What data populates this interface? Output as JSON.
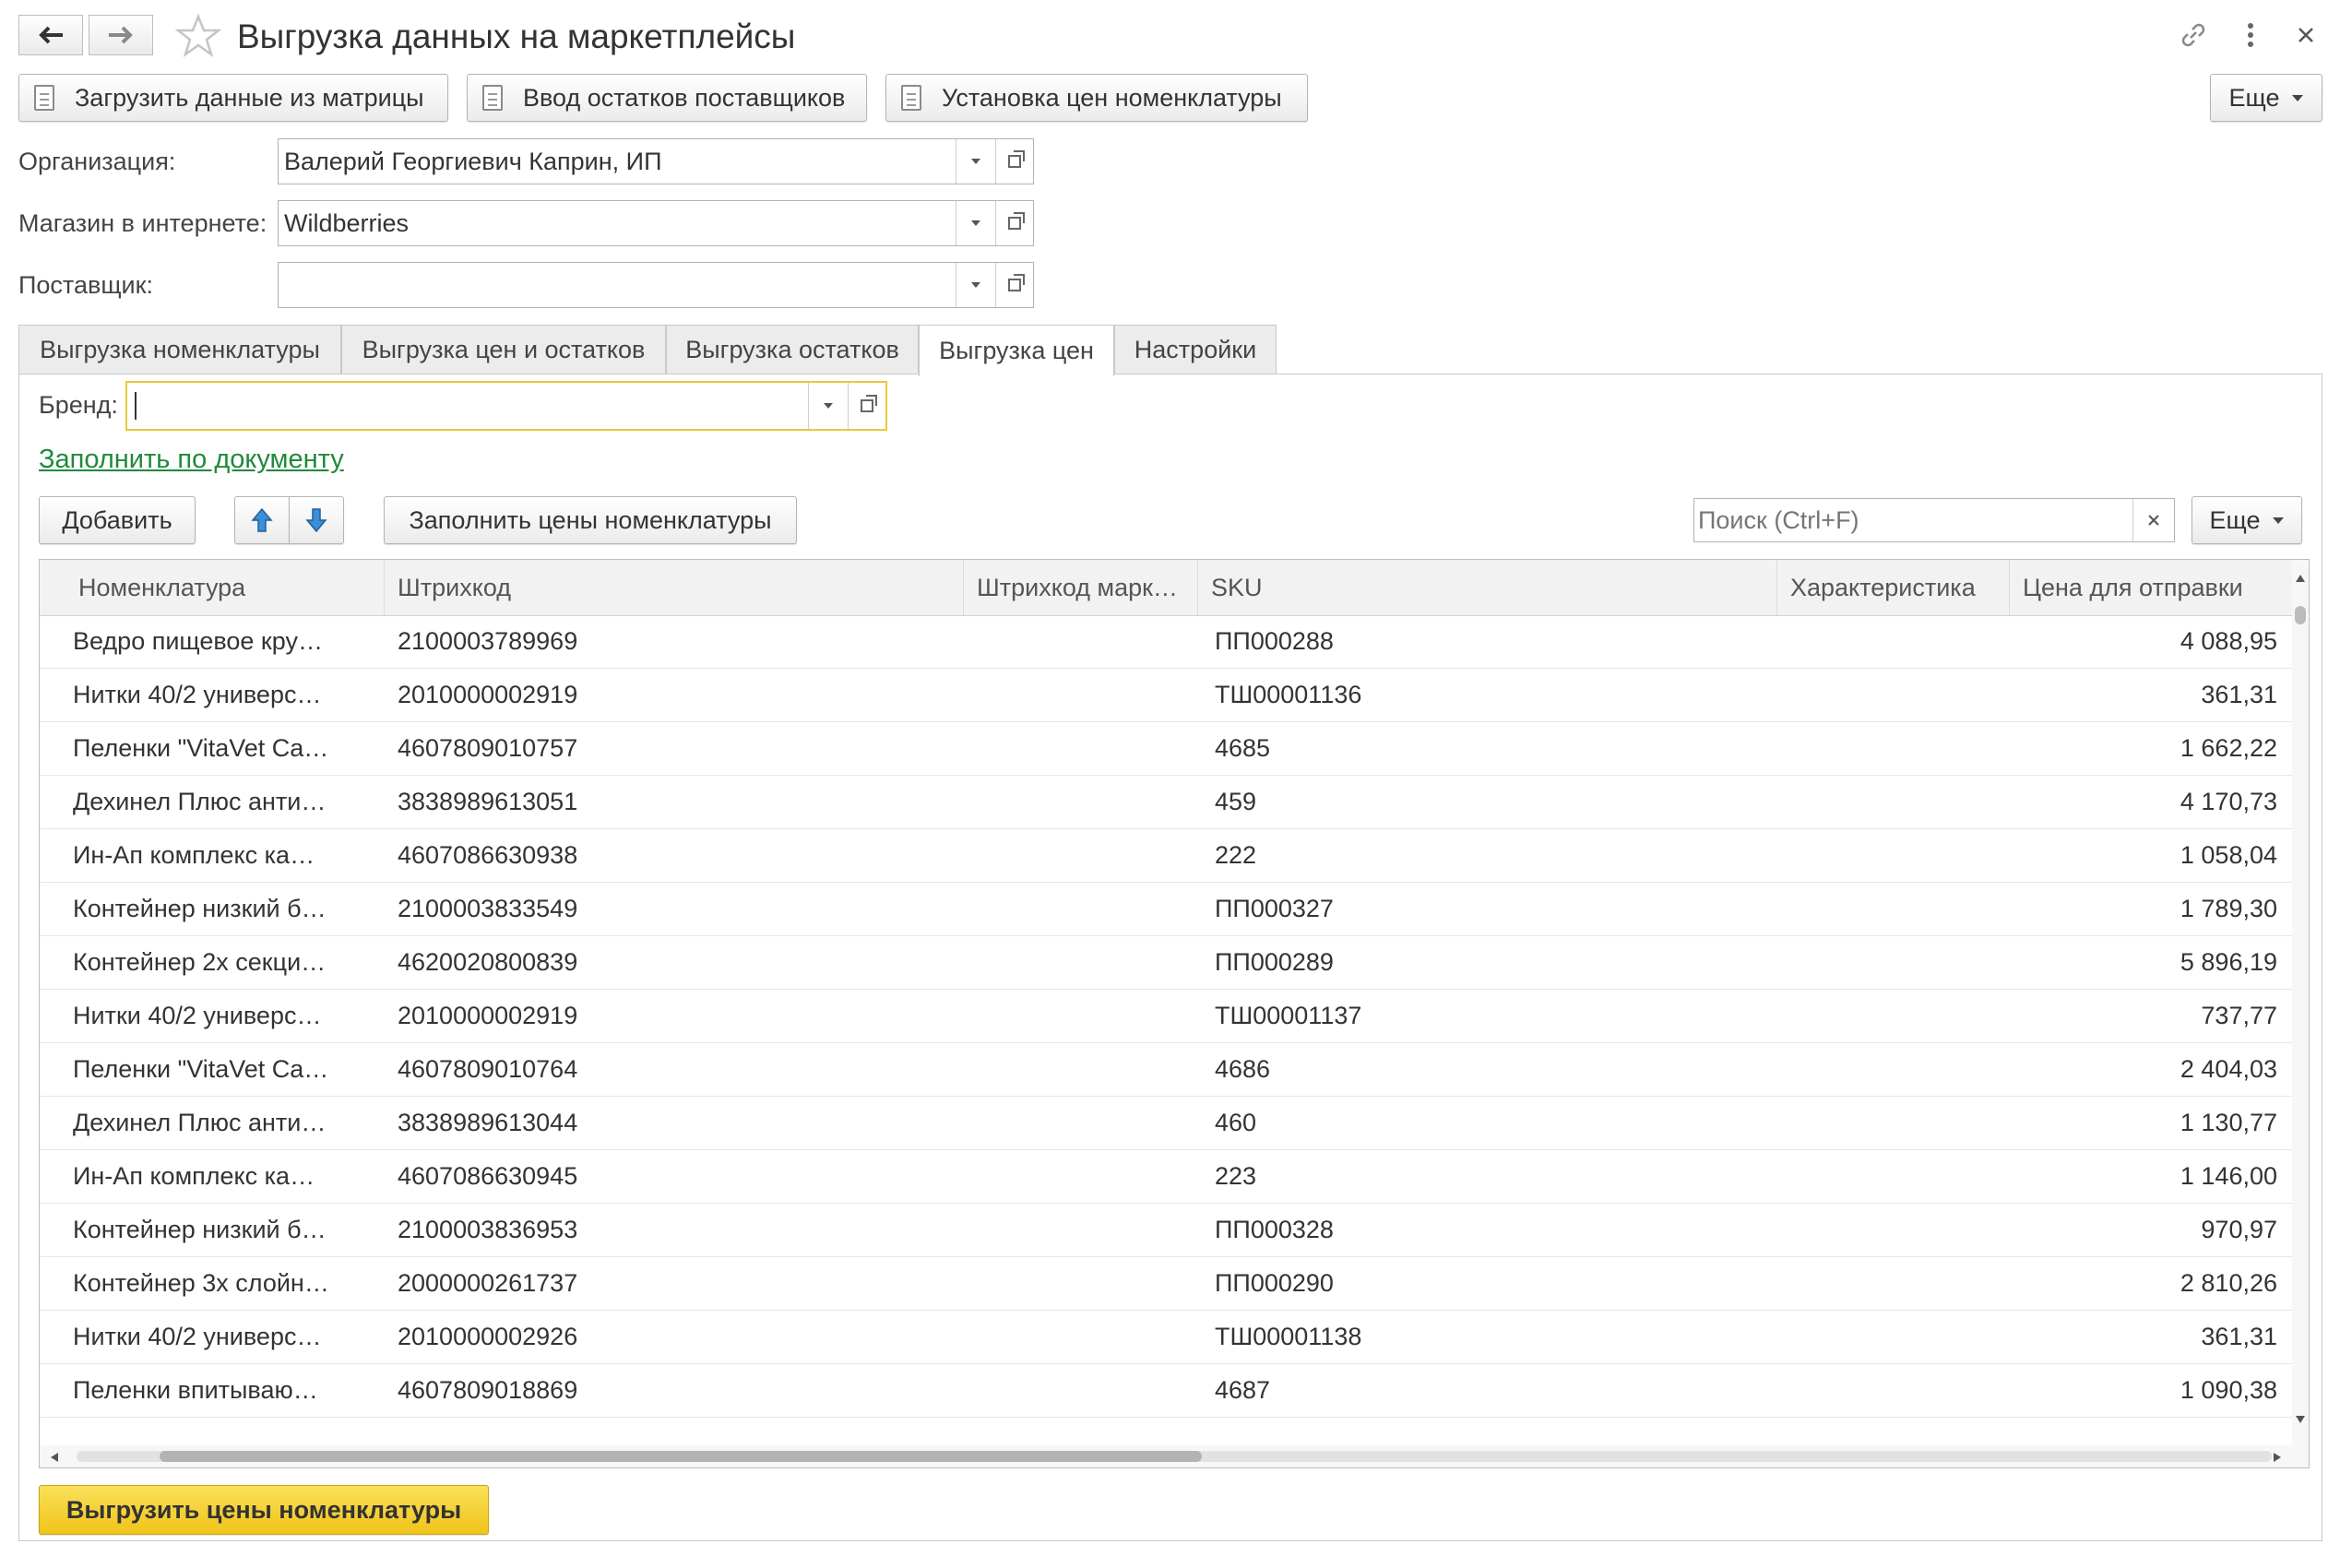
{
  "window": {
    "title": "Выгрузка данных на маркетплейсы"
  },
  "toolbar": {
    "load_matrix": "Загрузить данные из матрицы",
    "supplier_stock": "Ввод остатков поставщиков",
    "set_prices": "Установка цен номенклатуры",
    "more": "Еще"
  },
  "form": {
    "org_label": "Организация:",
    "org_value": "Валерий Георгиевич Каприн, ИП",
    "shop_label": "Магазин в интернете:",
    "shop_value": "Wildberries",
    "supplier_label": "Поставщик:",
    "supplier_value": ""
  },
  "tabs": [
    {
      "label": "Выгрузка номенклатуры",
      "active": false
    },
    {
      "label": "Выгрузка цен и остатков",
      "active": false
    },
    {
      "label": "Выгрузка остатков",
      "active": false
    },
    {
      "label": "Выгрузка цен",
      "active": true
    },
    {
      "label": "Настройки",
      "active": false
    }
  ],
  "prices_tab": {
    "brand_label": "Бренд:",
    "brand_value": "",
    "fill_link": "Заполнить по документу",
    "add_button": "Добавить",
    "fill_prices_button": "Заполнить цены номенклатуры",
    "search_placeholder": "Поиск (Ctrl+F)",
    "more_button": "Еще",
    "export_button": "Выгрузить цены номенклатуры"
  },
  "table": {
    "columns": [
      "Номенклатура",
      "Штрихкод",
      "Штрихкод марк…",
      "SKU",
      "Характеристика",
      "Цена для отправки"
    ],
    "rows": [
      {
        "name": "Ведро пищевое кру…",
        "barcode": "2100003789969",
        "sku": "ПП000288",
        "price": "4 088,95"
      },
      {
        "name": "Нитки 40/2 универс…",
        "barcode": "2010000002919",
        "sku": "ТШ00001136",
        "price": "361,31"
      },
      {
        "name": "Пеленки \"VitaVet Ca…",
        "barcode": "4607809010757",
        "sku": "4685",
        "price": "1 662,22"
      },
      {
        "name": "Дехинел Плюс анти…",
        "barcode": "3838989613051",
        "sku": "459",
        "price": "4 170,73"
      },
      {
        "name": "Ин-Ап комплекс ка…",
        "barcode": "4607086630938",
        "sku": "222",
        "price": "1 058,04"
      },
      {
        "name": "Контейнер низкий б…",
        "barcode": "2100003833549",
        "sku": "ПП000327",
        "price": "1 789,30"
      },
      {
        "name": "Контейнер 2х секци…",
        "barcode": "4620020800839",
        "sku": "ПП000289",
        "price": "5 896,19"
      },
      {
        "name": "Нитки 40/2 универс…",
        "barcode": "2010000002919",
        "sku": "ТШ00001137",
        "price": "737,77"
      },
      {
        "name": "Пеленки \"VitaVet Ca…",
        "barcode": "4607809010764",
        "sku": "4686",
        "price": "2 404,03"
      },
      {
        "name": "Дехинел Плюс анти…",
        "barcode": "3838989613044",
        "sku": "460",
        "price": "1 130,77"
      },
      {
        "name": "Ин-Ап комплекс ка…",
        "barcode": "4607086630945",
        "sku": "223",
        "price": "1 146,00"
      },
      {
        "name": "Контейнер низкий б…",
        "barcode": "2100003836953",
        "sku": "ПП000328",
        "price": "970,97"
      },
      {
        "name": "Контейнер 3х слойн…",
        "barcode": "2000000261737",
        "sku": "ПП000290",
        "price": "2 810,26"
      },
      {
        "name": "Нитки 40/2 универс…",
        "barcode": "2010000002926",
        "sku": "ТШ00001138",
        "price": "361,31"
      },
      {
        "name": "Пеленки впитываю…",
        "barcode": "4607809018869",
        "sku": "4687",
        "price": "1 090,38"
      }
    ]
  },
  "colors": {
    "accent_yellow": "#f6d431",
    "link_green": "#1f8a3c",
    "focus_border": "#e8c93a"
  }
}
